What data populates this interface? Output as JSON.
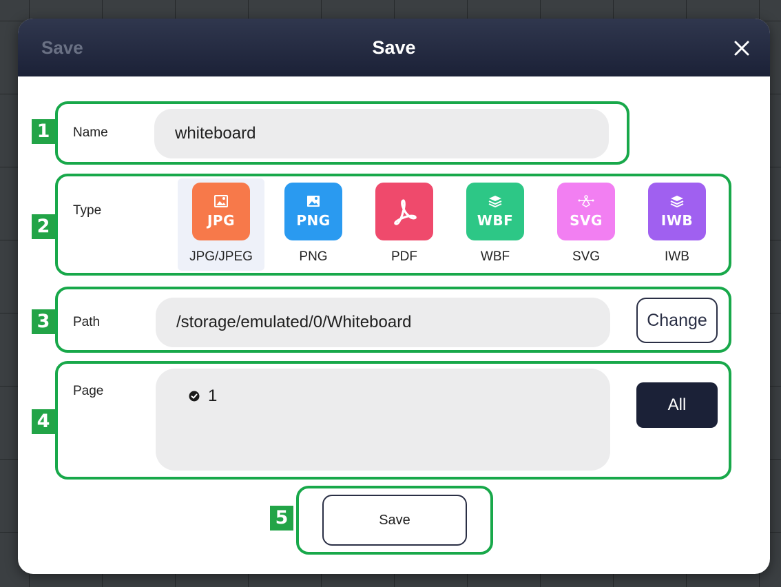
{
  "dialog": {
    "ghost_title": "Save",
    "title": "Save",
    "close_symbol": "×"
  },
  "badges": [
    "1",
    "2",
    "3",
    "4",
    "5"
  ],
  "name_row": {
    "label": "Name",
    "value": "whiteboard"
  },
  "type_row": {
    "label": "Type",
    "selected": "JPG/JPEG",
    "options": [
      {
        "ext": "JPG",
        "label": "JPG/JPEG",
        "color": "#f7794a",
        "icon": "image-icon"
      },
      {
        "ext": "PNG",
        "label": "PNG",
        "color": "#2a9af0",
        "icon": "image-icon"
      },
      {
        "ext": "",
        "label": "PDF",
        "color": "#ef4a6c",
        "icon": "pdf-acrobat-icon"
      },
      {
        "ext": "WBF",
        "label": "WBF",
        "color": "#2dc786",
        "icon": "layers-icon"
      },
      {
        "ext": "SVG",
        "label": "SVG",
        "color": "#f27ff2",
        "icon": "vector-pen-icon"
      },
      {
        "ext": "IWB",
        "label": "IWB",
        "color": "#a060f0",
        "icon": "layers-icon"
      }
    ]
  },
  "path_row": {
    "label": "Path",
    "value": "/storage/emulated/0/Whiteboard",
    "change_label": "Change"
  },
  "page_row": {
    "label": "Page",
    "pages": [
      "1"
    ],
    "all_label": "All"
  },
  "footer": {
    "save_label": "Save"
  },
  "colors": {
    "header": "#1b2137",
    "highlight": "#18a84a",
    "badge": "#22a447"
  }
}
